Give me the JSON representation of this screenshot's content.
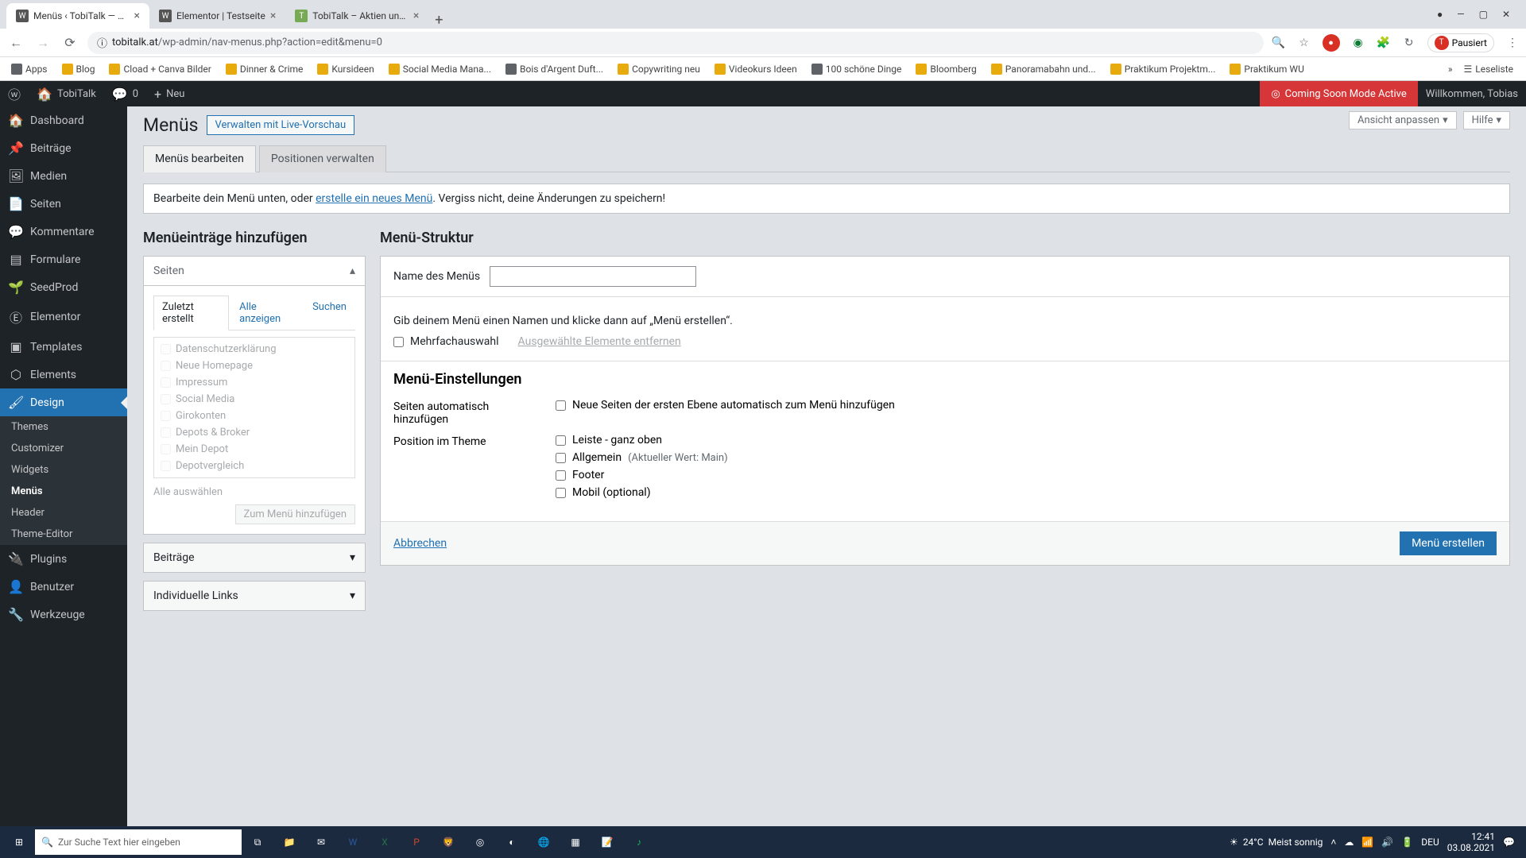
{
  "browser": {
    "tabs": [
      {
        "title": "Menüs ‹ TobiTalk — WordPress",
        "active": true
      },
      {
        "title": "Elementor | Testseite",
        "active": false
      },
      {
        "title": "TobiTalk – Aktien und persönlich...",
        "active": false
      }
    ],
    "url_host": "tobitalk.at",
    "url_path": "/wp-admin/nav-menus.php?action=edit&menu=0",
    "paused": "Pausiert",
    "bookmarks": [
      "Apps",
      "Blog",
      "Cload + Canva Bilder",
      "Dinner & Crime",
      "Kursideen",
      "Social Media Mana...",
      "Bois d'Argent Duft...",
      "Copywriting neu",
      "Videokurs Ideen",
      "100 schöne Dinge",
      "Bloomberg",
      "Panoramabahn und...",
      "Praktikum Projektm...",
      "Praktikum WU"
    ],
    "reading_list": "Leseliste"
  },
  "adminbar": {
    "site": "TobiTalk",
    "comments": "0",
    "new": "Neu",
    "coming_soon": "Coming Soon Mode Active",
    "welcome": "Willkommen, Tobias"
  },
  "sidebar": {
    "items": [
      {
        "icon": "⚙",
        "label": "Dashboard"
      },
      {
        "icon": "📌",
        "label": "Beiträge"
      },
      {
        "icon": "🖼",
        "label": "Medien"
      },
      {
        "icon": "📄",
        "label": "Seiten"
      },
      {
        "icon": "💬",
        "label": "Kommentare"
      },
      {
        "icon": "▤",
        "label": "Formulare"
      },
      {
        "icon": "🌱",
        "label": "SeedProd"
      },
      {
        "icon": "Ⓔ",
        "label": "Elementor"
      },
      {
        "icon": "▣",
        "label": "Templates"
      },
      {
        "icon": "⬡",
        "label": "Elements"
      },
      {
        "icon": "🖌",
        "label": "Design",
        "current": true
      },
      {
        "icon": "🔌",
        "label": "Plugins"
      },
      {
        "icon": "👤",
        "label": "Benutzer"
      },
      {
        "icon": "🔧",
        "label": "Werkzeuge"
      }
    ],
    "submenu": [
      "Themes",
      "Customizer",
      "Widgets",
      "Menüs",
      "Header",
      "Theme-Editor"
    ],
    "submenu_current": "Menüs"
  },
  "page": {
    "title": "Menüs",
    "live_preview": "Verwalten mit Live-Vorschau",
    "screen_options": "Ansicht anpassen",
    "help": "Hilfe",
    "tabs": {
      "edit": "Menüs bearbeiten",
      "positions": "Positionen verwalten"
    },
    "info_prefix": "Bearbeite dein Menü unten, oder ",
    "info_link": "erstelle ein neues Menü",
    "info_suffix": ". Vergiss nicht, deine Änderungen zu speichern!",
    "left": {
      "heading": "Menüeinträge hinzufügen",
      "acc_pages": "Seiten",
      "inner_tabs": {
        "recent": "Zuletzt erstellt",
        "all": "Alle anzeigen",
        "search": "Suchen"
      },
      "pages": [
        "Datenschutzerklärung",
        "Neue Homepage",
        "Impressum",
        "Social Media",
        "Girokonten",
        "Depots & Broker",
        "Mein Depot",
        "Depotvergleich"
      ],
      "select_all": "Alle auswählen",
      "add_btn": "Zum Menü hinzufügen",
      "acc_posts": "Beiträge",
      "acc_links": "Individuelle Links"
    },
    "right": {
      "heading": "Menü-Struktur",
      "name_label": "Name des Menüs",
      "instruction": "Gib deinem Menü einen Namen und klicke dann auf „Menü erstellen“.",
      "multiselect": "Mehrfachauswahl",
      "remove_selected": "Ausgewählte Elemente entfernen",
      "settings_heading": "Menü-Einstellungen",
      "auto_add_label": "Seiten automatisch hinzufügen",
      "auto_add_opt": "Neue Seiten der ersten Ebene automatisch zum Menü hinzufügen",
      "position_label": "Position im Theme",
      "positions": [
        {
          "label": "Leiste - ganz oben",
          "hint": ""
        },
        {
          "label": "Allgemein",
          "hint": "(Aktueller Wert: Main)"
        },
        {
          "label": "Footer",
          "hint": ""
        },
        {
          "label": "Mobil (optional)",
          "hint": ""
        }
      ],
      "cancel": "Abbrechen",
      "create": "Menü erstellen"
    }
  },
  "taskbar": {
    "search_placeholder": "Zur Suche Text hier eingeben",
    "weather_temp": "24°C",
    "weather_desc": "Meist sonnig",
    "lang": "DEU",
    "time": "12:41",
    "date": "03.08.2021"
  }
}
